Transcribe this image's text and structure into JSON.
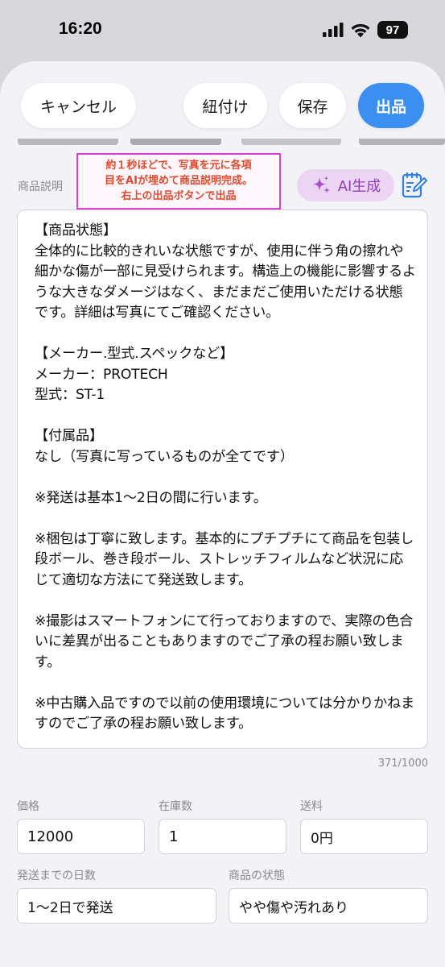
{
  "status_bar": {
    "time": "16:20",
    "battery": "97"
  },
  "header": {
    "cancel_label": "キャンセル",
    "link_label": "紐付け",
    "save_label": "保存",
    "publish_label": "出品",
    "publish_color": "#3a8ff0"
  },
  "description": {
    "section_label": "商品説明",
    "callout_lines": [
      "約１秒ほどで、写真を元に各項",
      "目をAIが埋めて商品説明完成。",
      "右上の出品ボタンで出品"
    ],
    "ai_button_label": "AI生成",
    "ai_icon": "sparkles-icon",
    "edit_icon": "edit-note-icon",
    "text": "【商品状態】\n全体的に比較的きれいな状態ですが、使用に伴う角の擦れや細かな傷が一部に見受けられます。構造上の機能に影響するような大きなダメージはなく、まだまだご使用いただける状態です。詳細は写真にてご確認ください。\n\n【メーカー.型式.スペックなど】\nメーカー：PROTECH\n型式：ST-1\n\n【付属品】\nなし（写真に写っているものが全てです）\n\n※発送は基本1〜2日の間に行います。\n\n※梱包は丁寧に致します。基本的にプチプチにて商品を包装し段ボール、巻き段ボール、ストレッチフィルムなど状況に応じて適切な方法にて発送致します。\n\n※撮影はスマートフォンにて行っておりますので、実際の色合いに差異が出ることもありますのでご了承の程お願い致します。\n\n※中古購入品ですので以前の使用環境については分かりかねますのでご了承の程お願い致します。",
    "char_count": "371/1000"
  },
  "fields": {
    "price": {
      "label": "価格",
      "value": "12000"
    },
    "stock": {
      "label": "在庫数",
      "value": "1"
    },
    "shipping_fee": {
      "label": "送料",
      "value": "0円"
    },
    "shipping_days": {
      "label": "発送までの日数",
      "value": "1〜2日で発送"
    },
    "condition": {
      "label": "商品の状態",
      "value": "やや傷や汚れあり"
    }
  }
}
